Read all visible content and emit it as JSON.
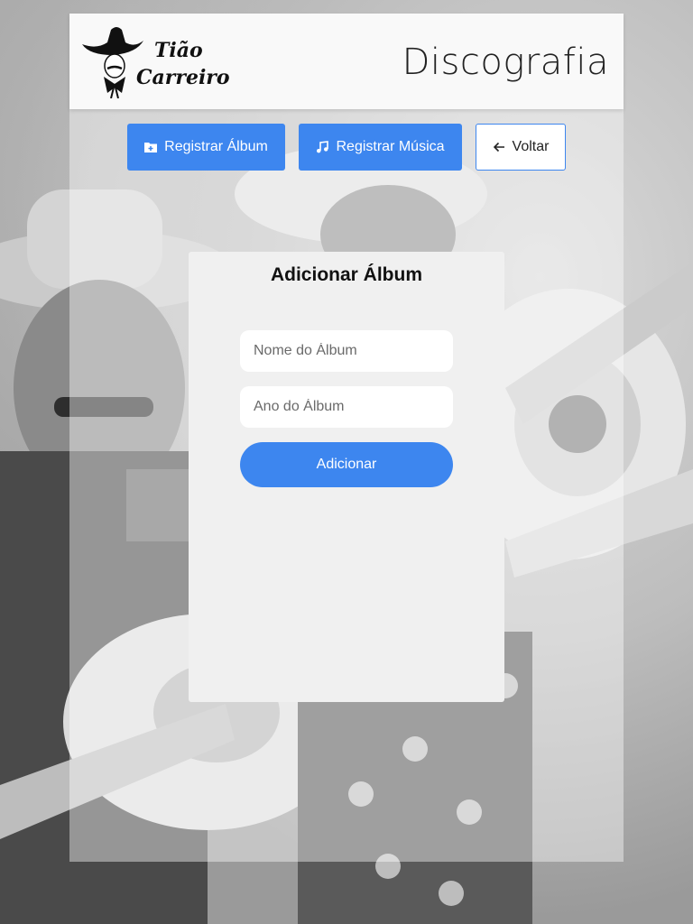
{
  "header": {
    "logo_text": "Tião Carreiro",
    "title": "Discografia"
  },
  "toolbar": {
    "register_album_label": "Registrar Álbum",
    "register_album_icon": "folder-add-icon",
    "register_music_label": "Registrar Música",
    "register_music_icon": "music-note-icon",
    "back_label": "Voltar",
    "back_icon": "arrow-left-icon"
  },
  "form": {
    "title": "Adicionar Álbum",
    "album_name": {
      "value": "",
      "placeholder": "Nome do Álbum"
    },
    "album_year": {
      "value": "",
      "placeholder": "Ano do Álbum"
    },
    "submit_label": "Adicionar"
  },
  "colors": {
    "accent": "#3d86ef",
    "header_bg": "#f9f9f9",
    "card_bg": "#f0f0f0"
  }
}
